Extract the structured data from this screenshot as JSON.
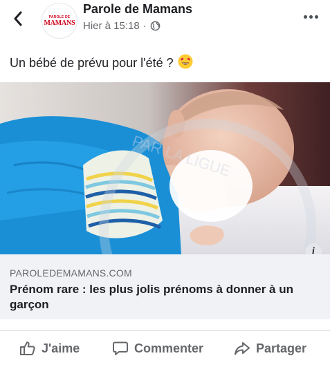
{
  "post": {
    "page_name": "Parole de Mamans",
    "timestamp": "Hier à 15:18",
    "separator": "·",
    "audience_icon": "globe-icon",
    "avatar_text_small": "PAROLE DE",
    "avatar_text_big": "MAMANS",
    "text": "Un bébé de prévu pour l'été ?",
    "emoji": "heart-eyes-emoji"
  },
  "link": {
    "domain": "PAROLEDEMAMANS.COM",
    "title": "Prénom rare : les plus jolis prénoms à donner à un garçon",
    "info_label": "i"
  },
  "actions": {
    "like": "J'aime",
    "comment": "Commenter",
    "share": "Partager"
  },
  "colors": {
    "brand_red": "#d0021b",
    "secondary_text": "#65676b",
    "card_bg": "#f0f2f5"
  }
}
